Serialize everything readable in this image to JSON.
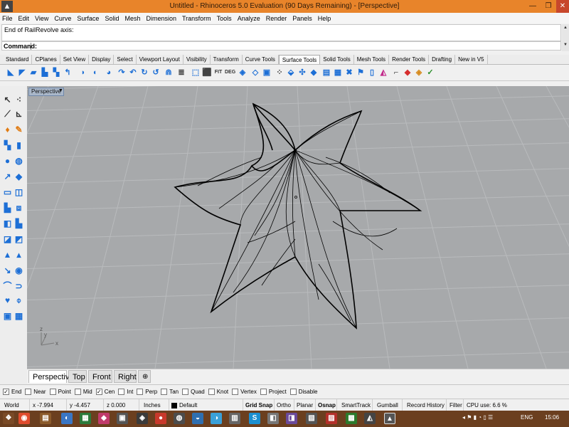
{
  "window": {
    "title": "Untitled - Rhinoceros 5.0 Evaluation (90 Days Remaining) - [Perspective]",
    "min_glyph": "—",
    "max_glyph": "❐",
    "close_glyph": "✕",
    "app_icon": "rhino-icon"
  },
  "menu": [
    "File",
    "Edit",
    "View",
    "Curve",
    "Surface",
    "Solid",
    "Mesh",
    "Dimension",
    "Transform",
    "Tools",
    "Analyze",
    "Render",
    "Panels",
    "Help"
  ],
  "command": {
    "history": "End of RailRevolve axis:",
    "prompt": "Command:",
    "value": ""
  },
  "toolbar_tabs": {
    "items": [
      "Standard",
      "CPlanes",
      "Set View",
      "Display",
      "Select",
      "Viewport Layout",
      "Visibility",
      "Transform",
      "Curve Tools",
      "Surface Tools",
      "Solid Tools",
      "Mesh Tools",
      "Render Tools",
      "Drafting",
      "New in V5"
    ],
    "active": "Surface Tools"
  },
  "viewport": {
    "label": "Perspective",
    "dropdown": "▼",
    "axis_x": "x",
    "axis_y": "y",
    "axis_z": "z",
    "background": "#a7a9ab",
    "grid_color": "#b6b8ba",
    "curve_color": "#000000"
  },
  "view_tabs": {
    "items": [
      "Perspective",
      "Top",
      "Front",
      "Right"
    ],
    "active": "Perspective",
    "add": "⊕"
  },
  "osnaps": [
    {
      "label": "End",
      "checked": true
    },
    {
      "label": "Near",
      "checked": false
    },
    {
      "label": "Point",
      "checked": false
    },
    {
      "label": "Mid",
      "checked": false
    },
    {
      "label": "Cen",
      "checked": true
    },
    {
      "label": "Int",
      "checked": false
    },
    {
      "label": "Perp",
      "checked": false
    },
    {
      "label": "Tan",
      "checked": false
    },
    {
      "label": "Quad",
      "checked": false
    },
    {
      "label": "Knot",
      "checked": false
    },
    {
      "label": "Vertex",
      "checked": false
    },
    {
      "label": "Project",
      "checked": false
    },
    {
      "label": "Disable",
      "checked": false
    }
  ],
  "status": {
    "cplane": "World",
    "x": "x -7.994",
    "y": "y -4.457",
    "z": "z 0.000",
    "units": "Inches",
    "layer": "Default",
    "grid_snap": "Grid Snap",
    "ortho": "Ortho",
    "planar": "Planar",
    "osnap": "Osnap",
    "smarttrack": "SmartTrack",
    "gumball": "Gumball",
    "record_history": "Record History",
    "filter": "Filter",
    "cpu": "CPU use: 6.6 %"
  },
  "taskbar": {
    "lang": "ENG",
    "time": "15:06"
  }
}
